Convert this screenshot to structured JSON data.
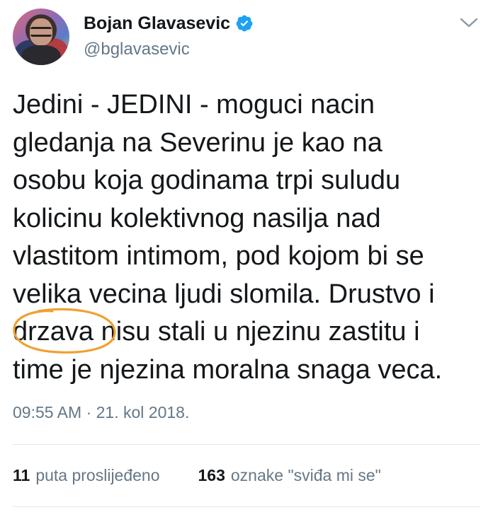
{
  "user": {
    "display_name": "Bojan Glavasevic",
    "handle": "@bglavasevic",
    "verified": true,
    "verified_color": "#1da1f2"
  },
  "tweet": {
    "lines": [
      "Jedini - JEDINI - moguci nacin",
      "gledanja na Severinu je kao na",
      "osobu koja godinama trpi suludu",
      "kolicinu kolektivnog nasilja nad",
      "vlastitom intimom, pod kojom bi se",
      "velika vecina ljudi slomila. Drustvo i",
      "drzava nisu stali u njezinu zastitu i",
      "time je njezina moralna snaga veca."
    ],
    "timestamp": "09:55 AM · 21. kol 2018."
  },
  "stats": {
    "retweets_count": "11",
    "retweets_label": "puta proslijeđeno",
    "likes_count": "163",
    "likes_label": "oznake \"sviđa mi se\""
  },
  "annotation": {
    "color": "#f0a030"
  },
  "icons": {
    "menu": "chevron-down-icon",
    "verified": "verified-badge-icon"
  }
}
